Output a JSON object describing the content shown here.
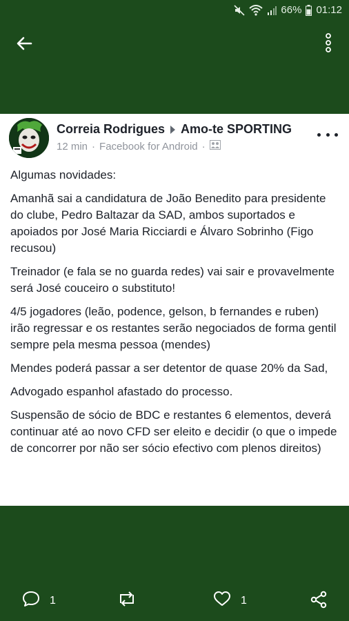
{
  "status": {
    "battery": "66%",
    "time": "01:12"
  },
  "post": {
    "author": "Correia Rodrigues",
    "group": "Amo-te SPORTING",
    "time": "12 min",
    "via": "Facebook for Android",
    "paragraphs": [
      "Algumas novidades:",
      "Amanhã sai a candidatura de João Benedito para presidente do clube, Pedro Baltazar da SAD, ambos suportados e apoiados por José Maria Ricciardi e Álvaro Sobrinho (Figo recusou)",
      "Treinador (e fala se no guarda redes) vai sair e provavelmente será José couceiro o substituto!",
      "4/5 jogadores (leão, podence, gelson, b fernandes e ruben) irão regressar e os restantes serão negociados de forma gentil sempre pela mesma pessoa (mendes)",
      "Mendes poderá passar a ser detentor de quase 20% da Sad,",
      "Advogado espanhol afastado do processo.",
      "Suspensão de sócio de BDC e restantes 6 elementos, deverá continuar até ao novo CFD ser eleito e decidir (o que o impede de concorrer por não ser sócio efectivo com plenos direitos)"
    ]
  },
  "actions": {
    "comments": "1",
    "likes": "1"
  }
}
